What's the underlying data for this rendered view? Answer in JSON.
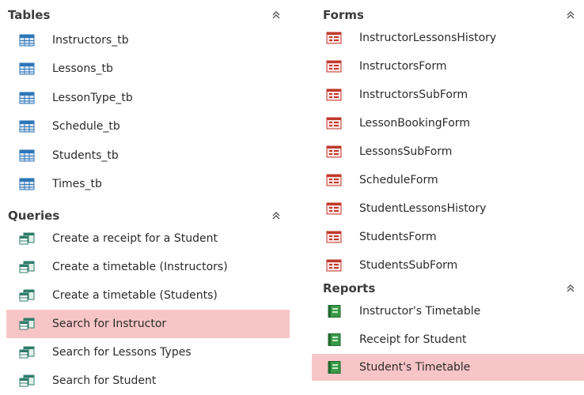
{
  "left": {
    "tables": {
      "title": "Tables",
      "items": [
        {
          "label": "Instructors_tb"
        },
        {
          "label": "Lessons_tb"
        },
        {
          "label": "LessonType_tb"
        },
        {
          "label": "Schedule_tb"
        },
        {
          "label": "Students_tb"
        },
        {
          "label": "Times_tb"
        }
      ]
    },
    "queries": {
      "title": "Queries",
      "items": [
        {
          "label": "Create a receipt for a Student"
        },
        {
          "label": "Create a timetable (Instructors)"
        },
        {
          "label": "Create a timetable (Students)"
        },
        {
          "label": "Search for Instructor",
          "selected": true
        },
        {
          "label": "Search for Lessons Types"
        },
        {
          "label": "Search for Student"
        }
      ]
    }
  },
  "right": {
    "forms": {
      "title": "Forms",
      "items": [
        {
          "label": "InstructorLessonsHistory"
        },
        {
          "label": "InstructorsForm"
        },
        {
          "label": "InstructorsSubForm"
        },
        {
          "label": "LessonBookingForm"
        },
        {
          "label": "LessonsSubForm"
        },
        {
          "label": "ScheduleForm"
        },
        {
          "label": "StudentLessonsHistory"
        },
        {
          "label": "StudentsForm"
        },
        {
          "label": "StudentsSubForm"
        }
      ]
    },
    "reports": {
      "title": "Reports",
      "items": [
        {
          "label": "Instructor's Timetable"
        },
        {
          "label": "Receipt for Student"
        },
        {
          "label": "Student's Timetable",
          "selected": true
        }
      ]
    }
  },
  "colors": {
    "selection": "#f8c5c6",
    "table_icon": "#2e75b6",
    "form_icon": "#c0392b",
    "report_icon": "#2e8b3e",
    "query_icon": "#2f7d6b"
  }
}
